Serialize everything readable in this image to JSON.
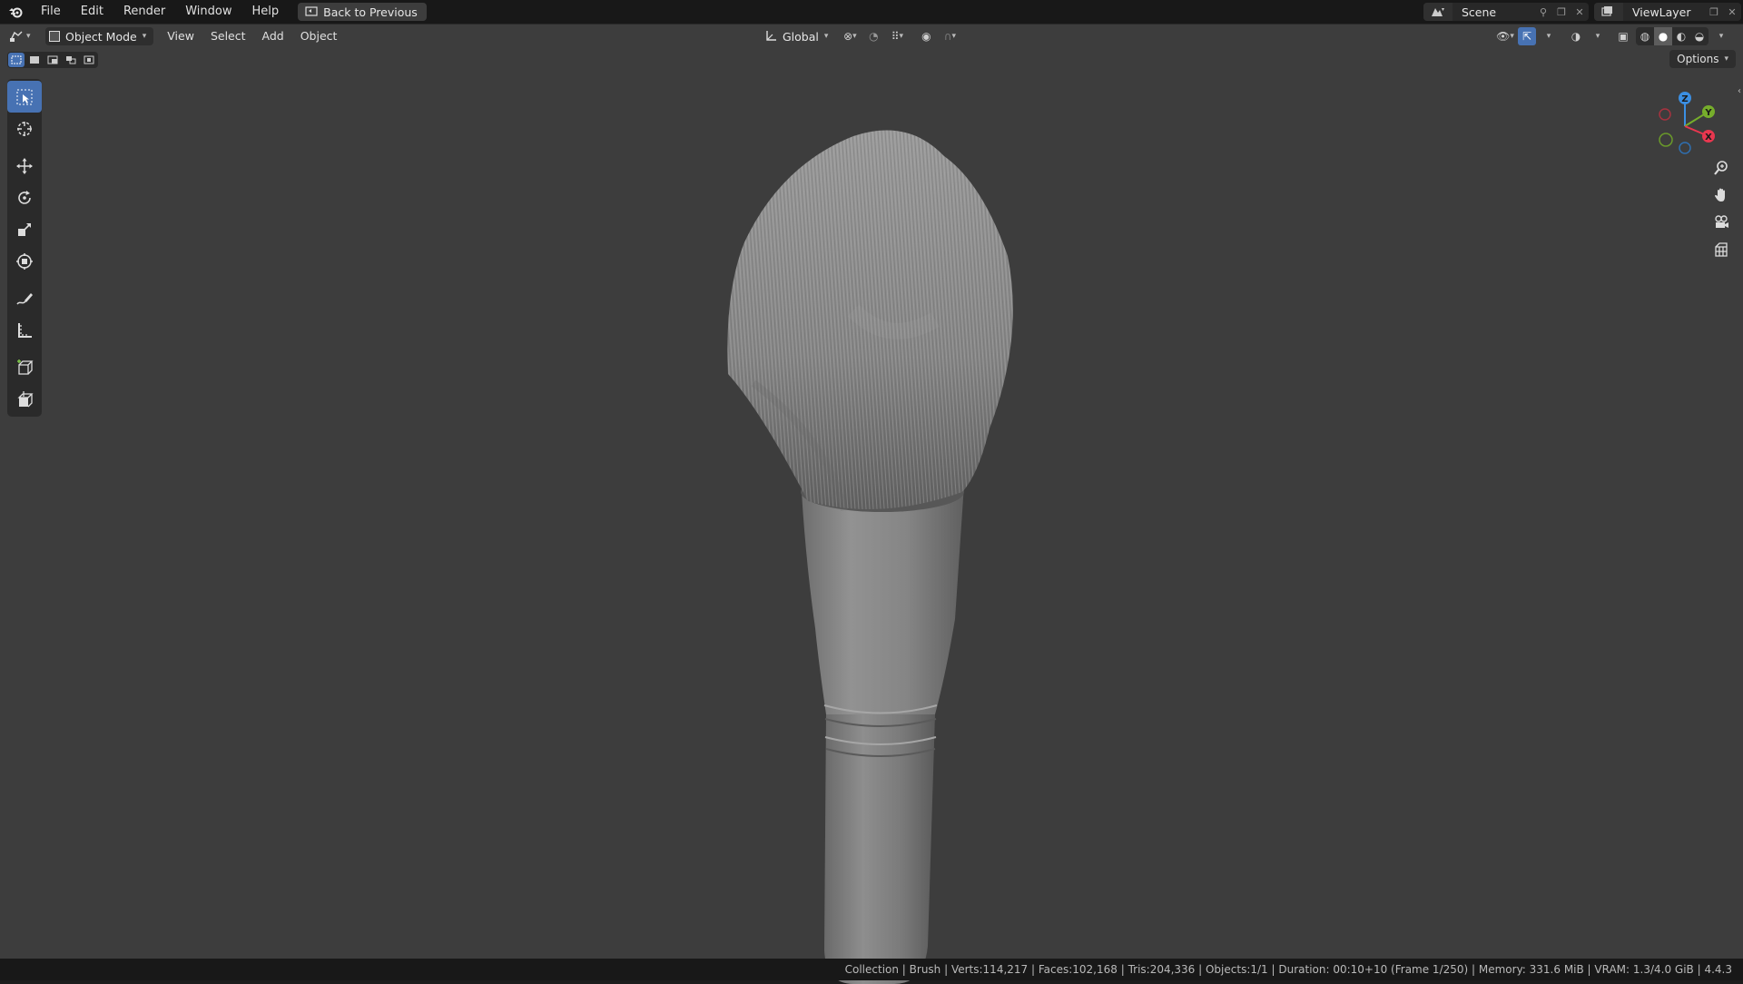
{
  "menu": {
    "file": "File",
    "edit": "Edit",
    "render": "Render",
    "window": "Window",
    "help": "Help",
    "back_to_previous": "Back to Previous"
  },
  "scene": {
    "name": "Scene"
  },
  "view_layer": {
    "name": "ViewLayer"
  },
  "viewport_header": {
    "mode": "Object Mode",
    "view": "View",
    "select": "Select",
    "add": "Add",
    "object": "Object",
    "transform_orientation": "Global",
    "options": "Options"
  },
  "status_bar": {
    "text": "Collection | Brush | Verts:114,217 | Faces:102,168 | Tris:204,336 | Objects:1/1 | Duration: 00:10+10 (Frame 1/250) | Memory: 331.6 MiB | VRAM: 1.3/4.0 GiB | 4.4.3"
  },
  "gizmo": {
    "x": "X",
    "y": "Y",
    "z": "Z"
  },
  "colors": {
    "accent": "#4772b3",
    "axis_x": "#e8374f",
    "axis_y": "#76ad2b",
    "axis_z": "#3b8fe3",
    "viewport_bg": "#3d3d3d"
  },
  "icons": {
    "toolbar": [
      "select-box-icon",
      "cursor-icon",
      "move-icon",
      "rotate-icon",
      "scale-icon",
      "transform-icon",
      "annotate-icon",
      "measure-icon",
      "add-cube-icon",
      "add-primitive-icon"
    ],
    "nav": [
      "zoom-icon",
      "pan-hand-icon",
      "camera-icon",
      "grid-ortho-icon"
    ]
  }
}
